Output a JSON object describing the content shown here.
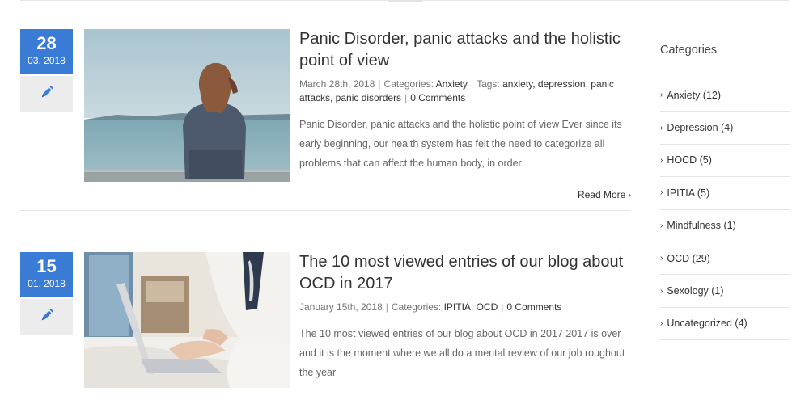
{
  "posts": [
    {
      "day": "28",
      "month_year": "03, 2018",
      "format_icon": "pencil-icon",
      "title": "Panic Disorder, panic attacks and the holistic point of view",
      "date": "March 28th, 2018",
      "categories_label": "Categories:",
      "categories": "Anxiety",
      "tags_label": "Tags:",
      "tags": "anxiety, depression, panic attacks, panic disorders",
      "comments": "0 Comments",
      "excerpt": "Panic Disorder, panic attacks and the holistic point of view   Ever since its early beginning, our health system has felt the need to categorize all problems that can affect the human body, in order",
      "read_more": "Read More"
    },
    {
      "day": "15",
      "month_year": "01, 2018",
      "format_icon": "pencil-icon",
      "title": "The 10 most viewed entries of our blog about OCD in 2017",
      "date": "January 15th, 2018",
      "categories_label": "Categories:",
      "categories": "IPITIA, OCD",
      "comments": "0 Comments",
      "excerpt": "The 10 most viewed entries of our blog about OCD in 2017 2017 is over and it is the moment where we all do a mental review of our job roughout the year"
    }
  ],
  "sidebar": {
    "title": "Categories",
    "items": [
      {
        "label": "Anxiety (12)"
      },
      {
        "label": "Depression (4)"
      },
      {
        "label": "HOCD (5)"
      },
      {
        "label": "IPITIA (5)"
      },
      {
        "label": "Mindfulness (1)"
      },
      {
        "label": "OCD (29)"
      },
      {
        "label": "Sexology (1)"
      },
      {
        "label": "Uncategorized (4)"
      }
    ]
  },
  "colors": {
    "accent": "#3a7bd5",
    "format_box": "#ececec",
    "divider": "#e4e4e4"
  }
}
